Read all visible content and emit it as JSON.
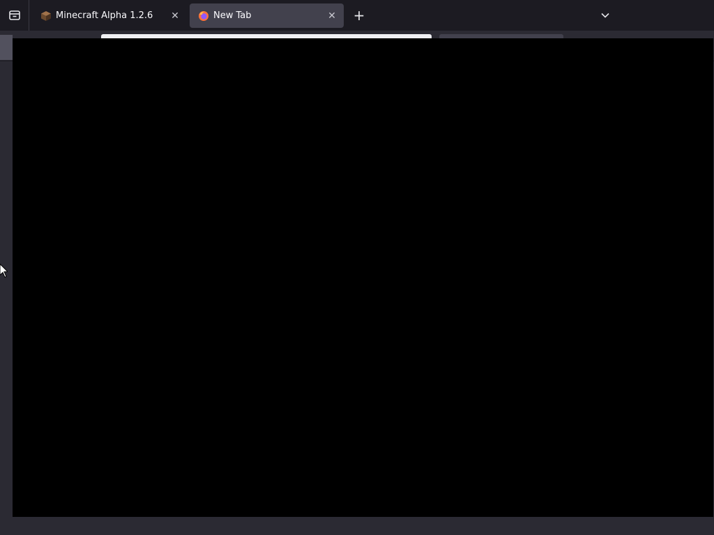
{
  "tabs": [
    {
      "label": "Minecraft Alpha 1.2.6",
      "favicon": "minecraft-block-icon",
      "active": false
    },
    {
      "label": "New Tab",
      "favicon": "firefox-icon",
      "active": true
    }
  ],
  "icons": {
    "tab_manager": "tab-manager-icon",
    "close": "close-icon",
    "new_tab": "plus-icon",
    "list_all_tabs": "chevron-down-icon"
  },
  "glyphs": {
    "close": "✕",
    "new_tab": "+"
  },
  "colors": {
    "tabstrip_bg": "#1c1b22",
    "active_tab_bg": "#42414d",
    "toolbar_bg": "#2b2a33",
    "content_bg": "#000000"
  }
}
